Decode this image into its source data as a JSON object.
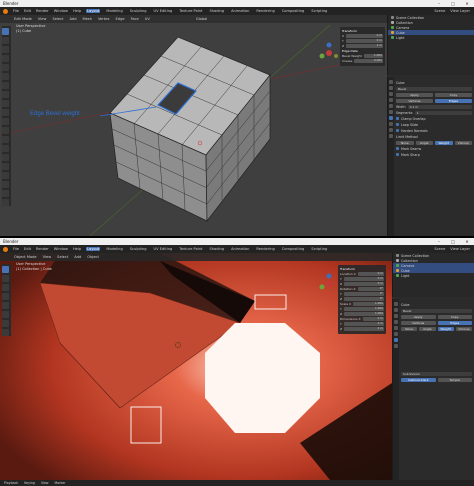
{
  "app": {
    "name": "Blender",
    "menu": [
      "File",
      "Edit",
      "Render",
      "Window",
      "Help"
    ],
    "workspaces": [
      "Layout",
      "Modeling",
      "Sculpting",
      "UV Editing",
      "Texture Paint",
      "Shading",
      "Animation",
      "Rendering",
      "Compositing",
      "Scripting"
    ],
    "active_workspace": "Layout"
  },
  "top": {
    "window_title": "Blender",
    "scene_label": "Scene",
    "view_layer_label": "View Layer",
    "mode": "Edit Mode",
    "header_menu": [
      "View",
      "Select",
      "Add",
      "Mesh",
      "Vertex",
      "Edge",
      "Face",
      "UV"
    ],
    "transform_label": "Global",
    "viewport_title": "User Perspective",
    "viewport_object": "(1) Cube",
    "annotation": "Edge Bevel weight",
    "npanel": {
      "title": "Transform",
      "rows": [
        {
          "label": "X",
          "value": "0 m"
        },
        {
          "label": "Y",
          "value": "0 m"
        },
        {
          "label": "Z",
          "value": "1 m"
        }
      ],
      "section2": "Edge Data",
      "rows2": [
        {
          "label": "Bevel Weight",
          "value": "1.000"
        },
        {
          "label": "Crease",
          "value": "0.000"
        }
      ]
    },
    "outliner": {
      "rows": [
        {
          "label": "Scene Collection",
          "selected": false,
          "color": "#888888"
        },
        {
          "label": "Collection",
          "selected": false,
          "color": "#aaaaaa"
        },
        {
          "label": "Camera",
          "selected": false,
          "color": "#4fa84f"
        },
        {
          "label": "Cube",
          "selected": true,
          "color": "#e0a030"
        },
        {
          "label": "Light",
          "selected": false,
          "color": "#4fa84f"
        }
      ]
    },
    "properties": {
      "object_name": "Cube",
      "modifier_name": "Bevel",
      "buttons": [
        "Apply",
        "Copy"
      ],
      "tabs": [
        "Vertices",
        "Edges"
      ],
      "fields": [
        {
          "label": "Width",
          "value": "0.1 m"
        },
        {
          "label": "Segments",
          "value": "1"
        }
      ],
      "limit_label": "Limit Method",
      "limit_options": [
        "None",
        "Angle",
        "Weight",
        "VGroup"
      ],
      "active_limit": "Weight",
      "checks": [
        "Clamp Overlap",
        "Loop Slide",
        "Harden Normals",
        "Mark Seams",
        "Mark Sharp"
      ]
    }
  },
  "bottom": {
    "window_title": "Blender",
    "scene_label": "Scene",
    "view_layer_label": "View Layer",
    "mode": "Object Mode",
    "header_menu": [
      "View",
      "Select",
      "Add",
      "Object"
    ],
    "viewport_title": "User Perspective",
    "viewport_object": "(1) Collection | Cube",
    "npanel": {
      "title": "Transform",
      "rows": [
        {
          "label": "Location X",
          "value": "0 m"
        },
        {
          "label": "Y",
          "value": "0 m"
        },
        {
          "label": "Z",
          "value": "0 m"
        },
        {
          "label": "Rotation X",
          "value": "0°"
        },
        {
          "label": "Y",
          "value": "0°"
        },
        {
          "label": "Z",
          "value": "0°"
        },
        {
          "label": "Scale X",
          "value": "1.000"
        },
        {
          "label": "Y",
          "value": "1.000"
        },
        {
          "label": "Z",
          "value": "1.000"
        },
        {
          "label": "Dimensions X",
          "value": "2 m"
        },
        {
          "label": "Y",
          "value": "2 m"
        },
        {
          "label": "Z",
          "value": "2 m"
        }
      ]
    },
    "outliner": {
      "rows": [
        {
          "label": "Scene Collection",
          "selected": false,
          "color": "#888888"
        },
        {
          "label": "Collection",
          "selected": false,
          "color": "#aaaaaa"
        },
        {
          "label": "Camera",
          "selected": true,
          "color": "#4fa84f"
        },
        {
          "label": "Cube",
          "selected": true,
          "color": "#e0a030"
        },
        {
          "label": "Light",
          "selected": false,
          "color": "#4fa84f"
        }
      ]
    },
    "properties": {
      "object_name": "Cube",
      "modifier_name": "Bevel",
      "buttons": [
        "Apply",
        "Copy"
      ],
      "tabs": [
        "Vertices",
        "Edges"
      ],
      "limit_options": [
        "None",
        "Angle",
        "Weight",
        "VGroup"
      ],
      "active_limit": "Weight",
      "second_modifier": "Subdivision",
      "second_buttons": [
        "Catmull-Clark",
        "Simple"
      ]
    },
    "status": [
      "Playback",
      "Keying",
      "View",
      "Marker"
    ]
  },
  "colors": {
    "accent": "#4772b3",
    "grid_bg": "#3d3d3d",
    "render_red": "#c33a22",
    "annotation_blue": "#2d6fd4"
  }
}
